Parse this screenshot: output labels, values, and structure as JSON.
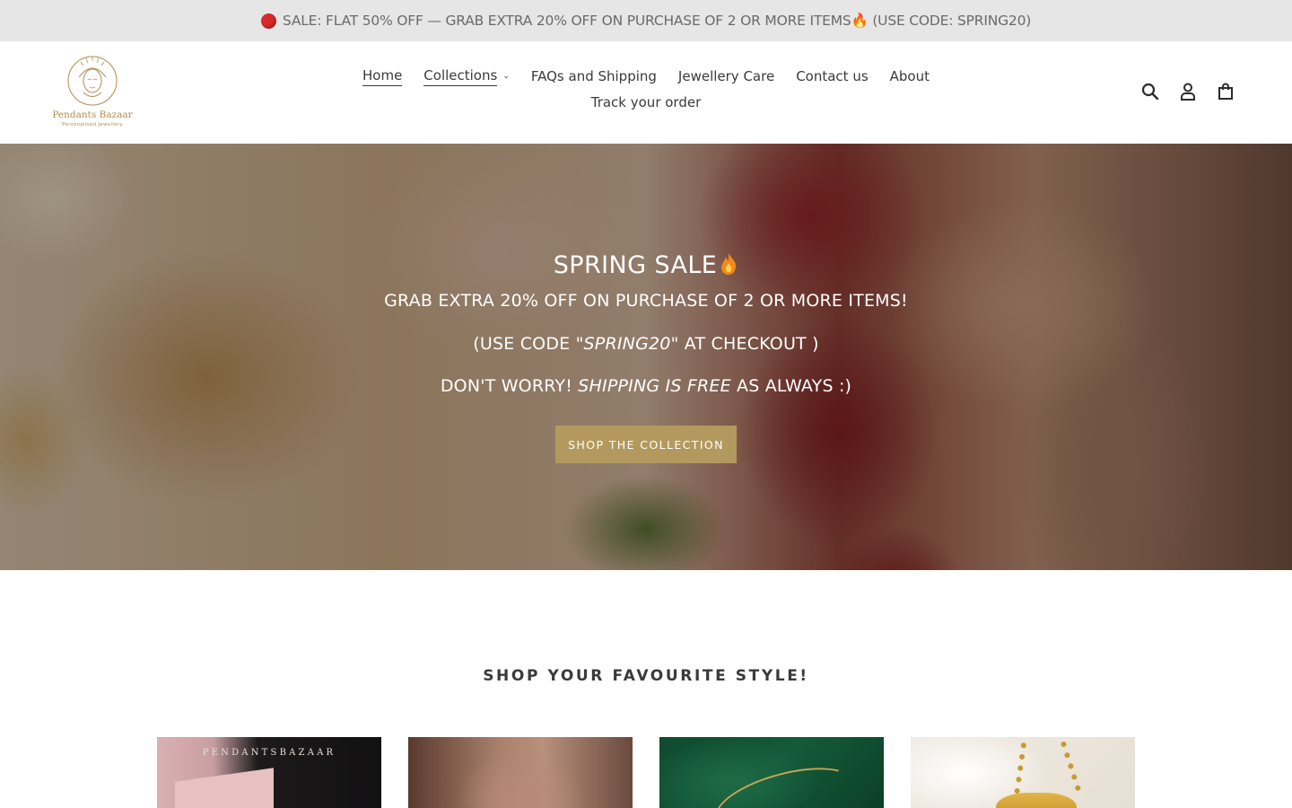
{
  "announcement": {
    "text": "SALE: FLAT 50% OFF — GRAB EXTRA 20% OFF ON PURCHASE OF 2 OR MORE ITEMS🔥 (USE CODE: SPRING20)"
  },
  "header": {
    "logo_name": "Pendants Bazaar",
    "logo_tagline": "Personalised Jewellery",
    "nav": {
      "home": "Home",
      "collections": "Collections",
      "faqs": "FAQs and Shipping",
      "care": "Jewellery Care",
      "contact": "Contact us",
      "about": "About",
      "track": "Track your order"
    },
    "icons": [
      "search-icon",
      "account-icon",
      "cart-icon"
    ]
  },
  "hero": {
    "title": "SPRING SALE",
    "line1": "GRAB EXTRA 20% OFF ON PURCHASE OF 2 OR MORE ITEMS!",
    "line2_pre": "(USE CODE ",
    "line2_code": "\"SPRING20\"",
    "line2_post": " AT CHECKOUT )",
    "line3_pre": "DON'T WORRY! ",
    "line3_em": "SHIPPING IS FREE",
    "line3_post": " AS ALWAYS :)",
    "button": "SHOP THE COLLECTION"
  },
  "section": {
    "title": "SHOP YOUR FAVOURITE STYLE!",
    "card1_brand": "PENDANTSBAZAAR"
  },
  "colors": {
    "announcement_bg": "#e6e6e6",
    "button_gold": "#b3995d",
    "logo_gold": "#b08d4f"
  }
}
